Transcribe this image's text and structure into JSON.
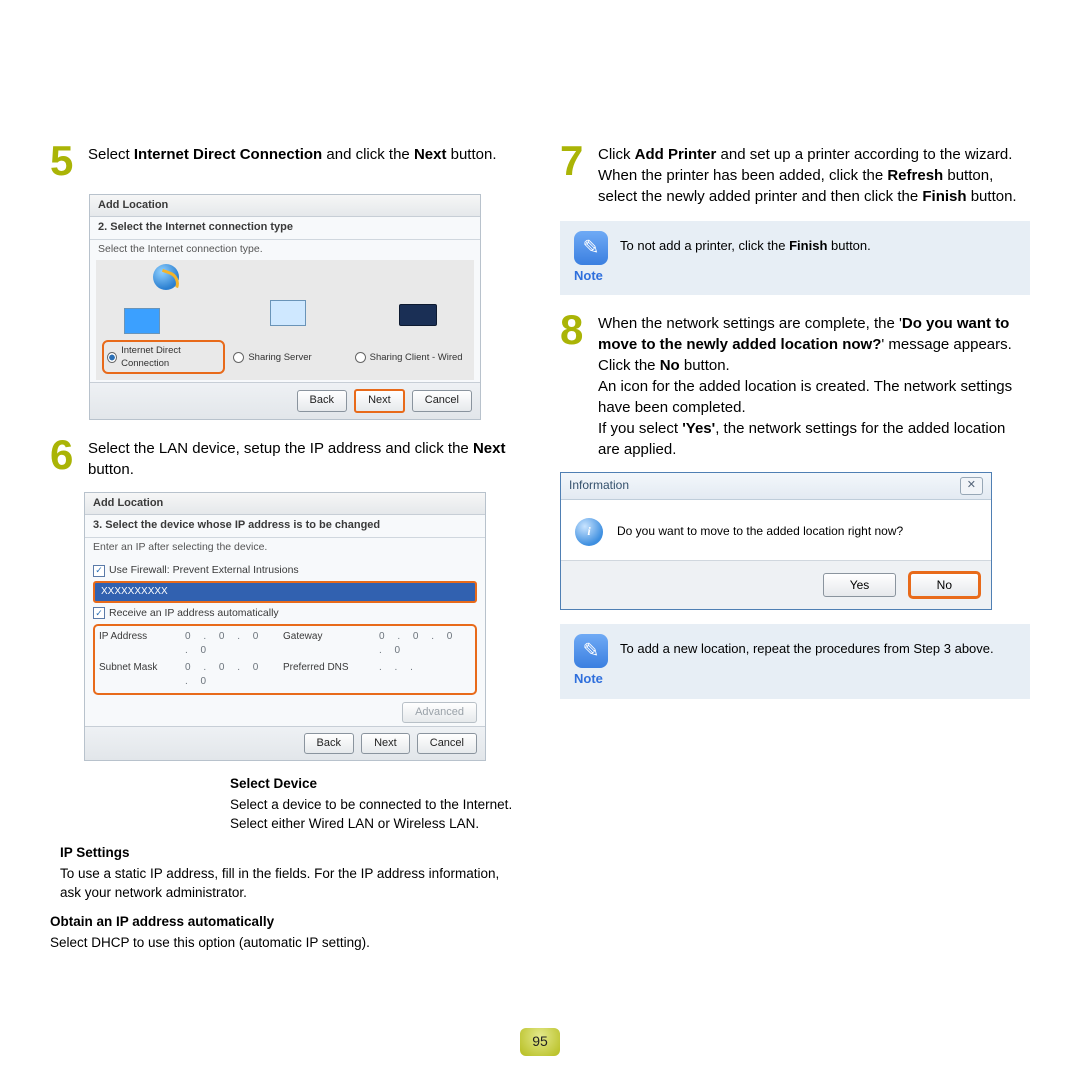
{
  "page_number": "95",
  "left": {
    "step5": {
      "num": "5",
      "pre": "Select ",
      "bold1": "Internet Direct Connection",
      "mid": " and click the ",
      "bold2": "Next",
      "post": " button."
    },
    "win1": {
      "title": "Add Location",
      "sub": "2. Select the Internet connection type",
      "hint": "Select the Internet connection type.",
      "opt_direct": "Internet Direct Connection",
      "opt_server": "Sharing Server",
      "opt_client": "Sharing Client - Wired",
      "back": "Back",
      "next": "Next",
      "cancel": "Cancel"
    },
    "step6": {
      "num": "6",
      "pre": "Select the LAN device, setup the IP address and click the ",
      "bold1": "Next",
      "post": " button."
    },
    "win2": {
      "title": "Add Location",
      "sub": "3. Select the device whose IP address is to be changed",
      "hint": "Enter an IP after selecting the device.",
      "chk_fw": "Use Firewall: Prevent External Intrusions",
      "device": "XXXXXXXXXX",
      "chk_auto": "Receive an IP address automatically",
      "ip_label": "IP Address",
      "ip_val": "0 . 0 . 0 . 0",
      "gw_label": "Gateway",
      "gw_val": "0 . 0 . 0 . 0",
      "sm_label": "Subnet Mask",
      "sm_val": "0 . 0 . 0 . 0",
      "dns_label": "Preferred DNS",
      "dns_val": ". . .",
      "adv": "Advanced",
      "back": "Back",
      "next": "Next",
      "cancel": "Cancel"
    },
    "call_device_h": "Select Device",
    "call_device_t": "Select a device to be connected to the Internet. Select either Wired LAN or Wireless LAN.",
    "call_ip_h": "IP Settings",
    "call_ip_t": "To use a static IP address, fill in the fields. For the IP address information, ask your network administrator.",
    "call_auto_h": "Obtain an IP address automatically",
    "call_auto_t": "Select DHCP to use this option (automatic IP setting)."
  },
  "right": {
    "step7": {
      "num": "7",
      "t1": "Click ",
      "b1": "Add Printer",
      "t2": " and set up a printer according to the wizard. When the printer has been added, click the ",
      "b2": "Refresh",
      "t3": " button, select the newly added printer and then click the ",
      "b3": "Finish",
      "t4": " button."
    },
    "note1_label": "Note",
    "note1_t1": "To not add a printer, click the ",
    "note1_b": "Finish",
    "note1_t2": " button.",
    "step8": {
      "num": "8",
      "l1a": "When the network settings are complete, the '",
      "l1b": "Do you want to move to the newly added location now?",
      "l1c": "' message appears. Click the ",
      "l1d": "No",
      "l1e": " button.",
      "l2": "An icon for the added location is created. The network settings have been completed.",
      "l3a": "If you select ",
      "l3b": "'Yes'",
      "l3c": ", the network settings for the added location are applied."
    },
    "dlg": {
      "title": "Information",
      "close": "✕",
      "msg": "Do you want to move to the added location right now?",
      "yes": "Yes",
      "no": "No"
    },
    "note2_label": "Note",
    "note2_t": "To add a new location, repeat the procedures from Step 3 above."
  }
}
